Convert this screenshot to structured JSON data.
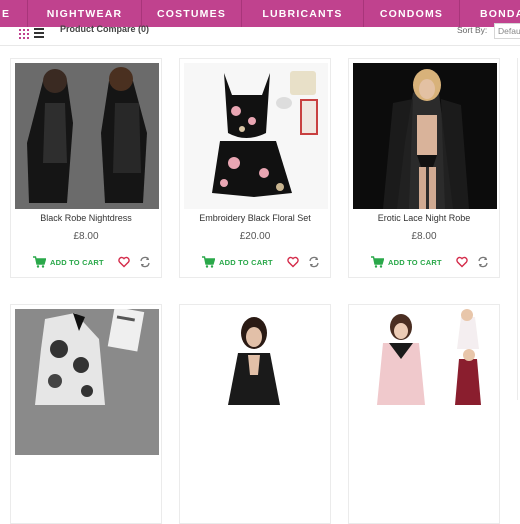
{
  "nav": {
    "items": [
      "E",
      "NIGHTWEAR",
      "COSTUMES",
      "LUBRICANTS",
      "CONDOMS",
      "BONDA"
    ]
  },
  "toolbar": {
    "compare_label": "Product Compare (0)",
    "sort_label": "Sort By:",
    "sort_value": "Defau"
  },
  "products": [
    {
      "title": "Black Robe Nightdress",
      "price": "£8.00",
      "cart_label": "ADD TO CART"
    },
    {
      "title": "Embroidery Black Floral Set",
      "price": "£20.00",
      "cart_label": "ADD TO CART"
    },
    {
      "title": "Erotic Lace Night Robe",
      "price": "£8.00",
      "cart_label": "ADD TO CART"
    },
    {
      "title": "",
      "price": "",
      "cart_label": ""
    },
    {
      "title": "",
      "price": "",
      "cart_label": ""
    },
    {
      "title": "",
      "price": "",
      "cart_label": ""
    }
  ],
  "icons": {
    "grid": "grid-view-icon",
    "list": "list-view-icon",
    "cart": "cart-icon",
    "wishlist": "heart-icon",
    "compare": "refresh-icon"
  },
  "colors": {
    "nav_bg": "#c0428e",
    "cart_green": "#2aa84a",
    "heart_red": "#d42b4a"
  }
}
